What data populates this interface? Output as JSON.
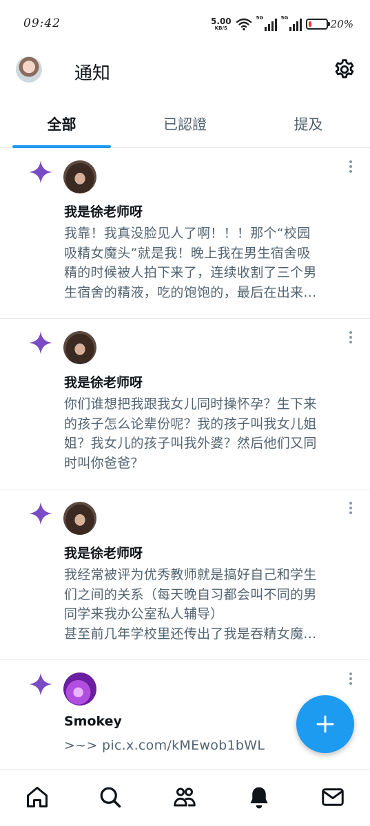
{
  "status_bar": {
    "time": "09:42",
    "net_speed": "5.00",
    "net_unit": "KB/S",
    "sim1_label": "5G",
    "sim2_label": "5G",
    "battery_percent": "20%",
    "battery_level": 0.2,
    "battery_color": "#e53935"
  },
  "header": {
    "title": "通知",
    "avatar_icon": "user-avatar",
    "settings_icon": "gear-icon"
  },
  "tabs": [
    {
      "label": "全部",
      "active": true
    },
    {
      "label": "已認證",
      "active": false
    },
    {
      "label": "提及",
      "active": false
    }
  ],
  "notifications": [
    {
      "icon": "sparkle-icon",
      "name": "我是徐老师呀",
      "text": "我靠！我真没脸见人了啊！！！那个“校园\n吸精女魔头”就是我！晚上我在男生宿舍吸\n精的时候被人拍下来了，连续收割了三个男\n生宿舍的精液，吃的饱饱的，最后在出来..."
    },
    {
      "icon": "sparkle-icon",
      "name": "我是徐老师呀",
      "text": "你们谁想把我跟我女儿同时操怀孕？生下来\n的孩子怎么论辈份呢？我的孩子叫我女儿姐\n姐？我女儿的孩子叫我外婆？然后他们又同\n时叫你爸爸？"
    },
    {
      "icon": "sparkle-icon",
      "name": "我是徐老师呀",
      "text": "我经常被评为优秀教师就是搞好自己和学生\n们之间的关系（每天晚自习都会叫不同的男\n同学来我办公室私人辅导）\n甚至前几年学校里还传出了我是吞精女魔..."
    },
    {
      "icon": "sparkle-icon",
      "name": "Smokey",
      "text": ">~> pic.x.com/kMEwob1bWL"
    }
  ],
  "fab": {
    "icon": "plus-icon"
  },
  "bottom_nav": [
    {
      "icon": "home-icon"
    },
    {
      "icon": "search-icon"
    },
    {
      "icon": "communities-icon"
    },
    {
      "icon": "bell-icon",
      "active": true
    },
    {
      "icon": "mail-icon"
    }
  ],
  "colors": {
    "accent": "#1d9bf0",
    "sparkle": "#794bc4",
    "secondary_text": "#536471"
  }
}
